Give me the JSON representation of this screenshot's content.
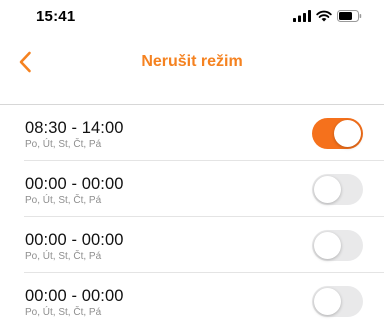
{
  "status_bar": {
    "time": "15:41",
    "icons": [
      "signal-icon",
      "wifi-icon",
      "battery-icon"
    ]
  },
  "nav": {
    "title": "Nerušit režim",
    "back_icon": "chevron-left-icon"
  },
  "colors": {
    "accent": "#f58220",
    "toggle_on": "#f5711c",
    "toggle_off": "#e9e9ea"
  },
  "schedules": [
    {
      "time": "08:30 - 14:00",
      "days": "Po, Út, St, Čt, Pá",
      "enabled": true
    },
    {
      "time": "00:00 - 00:00",
      "days": "Po, Út, St, Čt, Pá",
      "enabled": false
    },
    {
      "time": "00:00 - 00:00",
      "days": "Po, Út, St, Čt, Pá",
      "enabled": false
    },
    {
      "time": "00:00 - 00:00",
      "days": "Po, Út, St, Čt, Pá",
      "enabled": false
    }
  ]
}
